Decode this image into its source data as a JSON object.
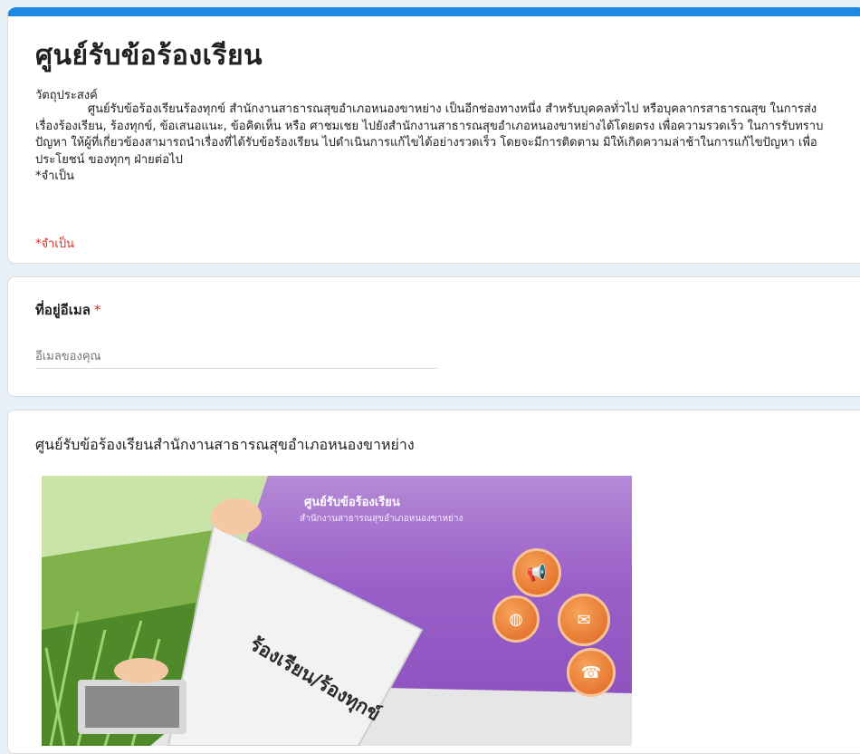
{
  "form": {
    "title": "ศูนย์รับข้อร้องเรียน",
    "description_heading": "วัตถุประสงค์",
    "description_body": "              ศูนย์รับข้อร้องเรียนร้องทุกข์ สำนักงานสาธารณสุขอำเภอหนองขาหย่าง เป็นอีกช่องทางหนึ่ง สำหรับบุคคลทั่วไป หรือบุคลากรสาธารณสุข ในการส่งเรื่องร้องเรียน, ร้องทุกข์, ข้อเสนอแนะ, ข้อคิดเห็น หรือ ศาชมเชย ไปยังสำนักงานสาธารณสุขอำเภอหนองขาหย่างได้โดยตรง เพื่อความรวดเร็ว ในการรับทราบปัญหา ให้ผู้ที่เกี่ยวข้องสามารถนำเรื่องที่ได้รับข้อร้องเรียน ไปดำเนินการแก้ไขได้อย่างรวดเร็ว โดยจะมีการติดตาม มิให้เกิดความล่าช้าในการแก้ไขปัญหา เพื่อประโยชน์ ของทุกๆ ฝ่ายต่อไป\n*จำเป็น",
    "required_note": "*จำเป็น"
  },
  "email_question": {
    "label": "ที่อยู่อีเมล",
    "required_mark": "*",
    "placeholder": "อีเมลของคุณ",
    "value": ""
  },
  "image_section": {
    "title": "ศูนย์รับข้อร้องเรียนสำนักงานสาธารณสุขอำเภอหนองขาหย่าง",
    "banner_title": "ศูนย์รับข้อร้องเรียน",
    "banner_subtitle": "สำนักงานสาธารณสุขอำเภอหนองขาหย่าง",
    "envelope_text": "ร้องเรียน/ร้องทุกข์",
    "icons": [
      "megaphone-icon",
      "globe-icon",
      "mail-icon",
      "phone-icon"
    ]
  },
  "colors": {
    "accent": "#1e88e5",
    "required": "#d93025",
    "background": "#e8f0f8",
    "banner_purple": "#9a5fc8",
    "icon_orange": "#e0651f"
  }
}
